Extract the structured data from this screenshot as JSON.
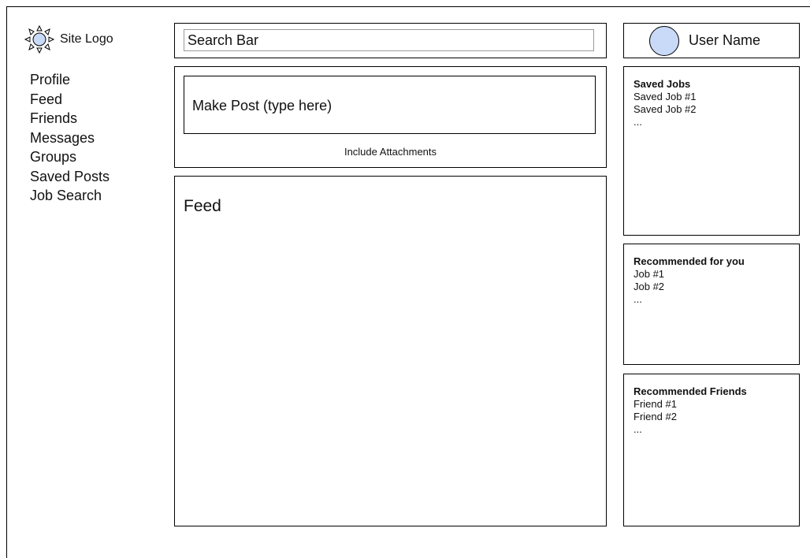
{
  "logo": {
    "text": "Site Logo",
    "icon": "sun-icon"
  },
  "nav": {
    "items": [
      {
        "label": "Profile"
      },
      {
        "label": "Feed"
      },
      {
        "label": "Friends"
      },
      {
        "label": "Messages"
      },
      {
        "label": "Groups"
      },
      {
        "label": "Saved Posts"
      },
      {
        "label": "Job Search"
      }
    ]
  },
  "search": {
    "placeholder": "Search Bar"
  },
  "post": {
    "placeholder": "Make Post (type here)",
    "attachments_label": "Include Attachments"
  },
  "feed": {
    "title": "Feed"
  },
  "user": {
    "name": "User Name",
    "avatar_color": "#c9daf8"
  },
  "saved_jobs": {
    "title": "Saved Jobs",
    "items": [
      "Saved Job #1",
      "Saved Job #2",
      "..."
    ]
  },
  "recommended_jobs": {
    "title": "Recommended for you",
    "items": [
      "Job #1",
      "Job #2",
      "..."
    ]
  },
  "recommended_friends": {
    "title": "Recommended Friends",
    "items": [
      "Friend #1",
      "Friend #2",
      "..."
    ]
  }
}
